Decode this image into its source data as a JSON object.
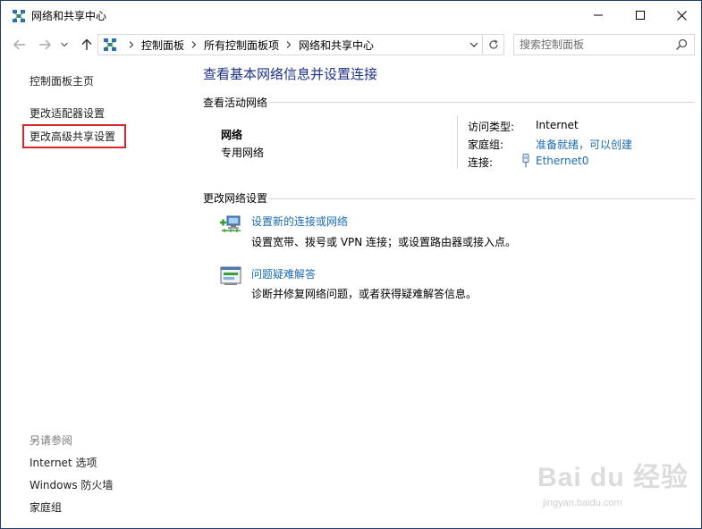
{
  "window": {
    "title": "网络和共享中心"
  },
  "address_bar": {
    "crumbs": [
      "控制面板",
      "所有控制面板项",
      "网络和共享中心"
    ],
    "search_placeholder": "搜索控制面板"
  },
  "left_pane": {
    "links": [
      "控制面板主页",
      "更改适配器设置",
      "更改高级共享设置"
    ],
    "see_also_heading": "另请参阅",
    "see_also": [
      "Internet 选项",
      "Windows 防火墙",
      "家庭组"
    ]
  },
  "main": {
    "title": "查看基本网络信息并设置连接",
    "active_networks_heading": "查看活动网络",
    "network": {
      "name": "网络",
      "type": "专用网络",
      "access_type_label": "访问类型:",
      "access_type_value": "Internet",
      "homegroup_label": "家庭组:",
      "homegroup_value": "准备就绪，可以创建",
      "connection_label": "连接:",
      "connection_value": "Ethernet0"
    },
    "change_settings_heading": "更改网络设置",
    "tasks": [
      {
        "link": "设置新的连接或网络",
        "desc": "设置宽带、拨号或 VPN 连接；或设置路由器或接入点。"
      },
      {
        "link": "问题疑难解答",
        "desc": "诊断并修复网络问题，或者获得疑难解答信息。"
      }
    ]
  },
  "watermark": {
    "text": "Bai du 经验",
    "sub": "jingyan.baidu.com"
  },
  "colors": {
    "link": "#1a6cb4",
    "title": "#1e3287",
    "highlight": "#d7262d"
  }
}
